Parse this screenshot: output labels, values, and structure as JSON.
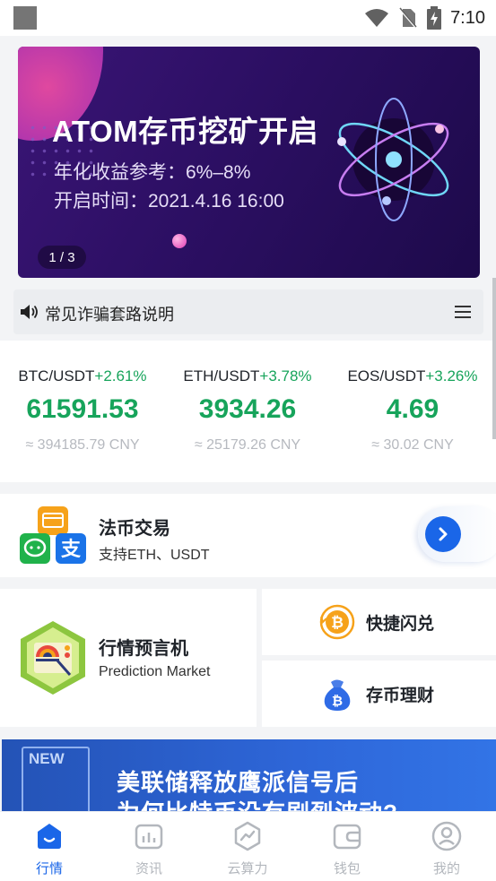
{
  "status_bar": {
    "time": "7:10"
  },
  "banner": {
    "title": "ATOM存币挖矿开启",
    "line1": "年化收益参考：6%–8%",
    "line2": "开启时间：2021.4.16 16:00",
    "pager": "1 / 3"
  },
  "notice": {
    "text": "常见诈骗套路说明"
  },
  "tickers": [
    {
      "pair": "BTC/USDT",
      "change": "+2.61%",
      "price": "61591.53",
      "cny": "≈ 394185.79 CNY"
    },
    {
      "pair": "ETH/USDT",
      "change": "+3.78%",
      "price": "3934.26",
      "cny": "≈ 25179.26 CNY"
    },
    {
      "pair": "EOS/USDT",
      "change": "+3.26%",
      "price": "4.69",
      "cny": "≈ 30.02 CNY"
    }
  ],
  "fiat": {
    "title": "法币交易",
    "subtitle": "支持ETH、USDT",
    "pay_icon_label": "支"
  },
  "prediction": {
    "title": "行情预言机",
    "subtitle": "Prediction Market"
  },
  "swap": {
    "label": "快捷闪兑"
  },
  "savings": {
    "label": "存币理财"
  },
  "news": {
    "tag": "NEW",
    "line1": "美联储释放鹰派信号后",
    "line2": "为何比特币没有剧烈波动?"
  },
  "tabs": [
    {
      "label": "行情",
      "icon": "market-icon",
      "active": true
    },
    {
      "label": "资讯",
      "icon": "news-icon",
      "active": false
    },
    {
      "label": "云算力",
      "icon": "cloud-power-icon",
      "active": false
    },
    {
      "label": "钱包",
      "icon": "wallet-icon",
      "active": false
    },
    {
      "label": "我的",
      "icon": "profile-icon",
      "active": false
    }
  ],
  "colors": {
    "accent": "#1a66e8",
    "up": "#17a45b"
  }
}
